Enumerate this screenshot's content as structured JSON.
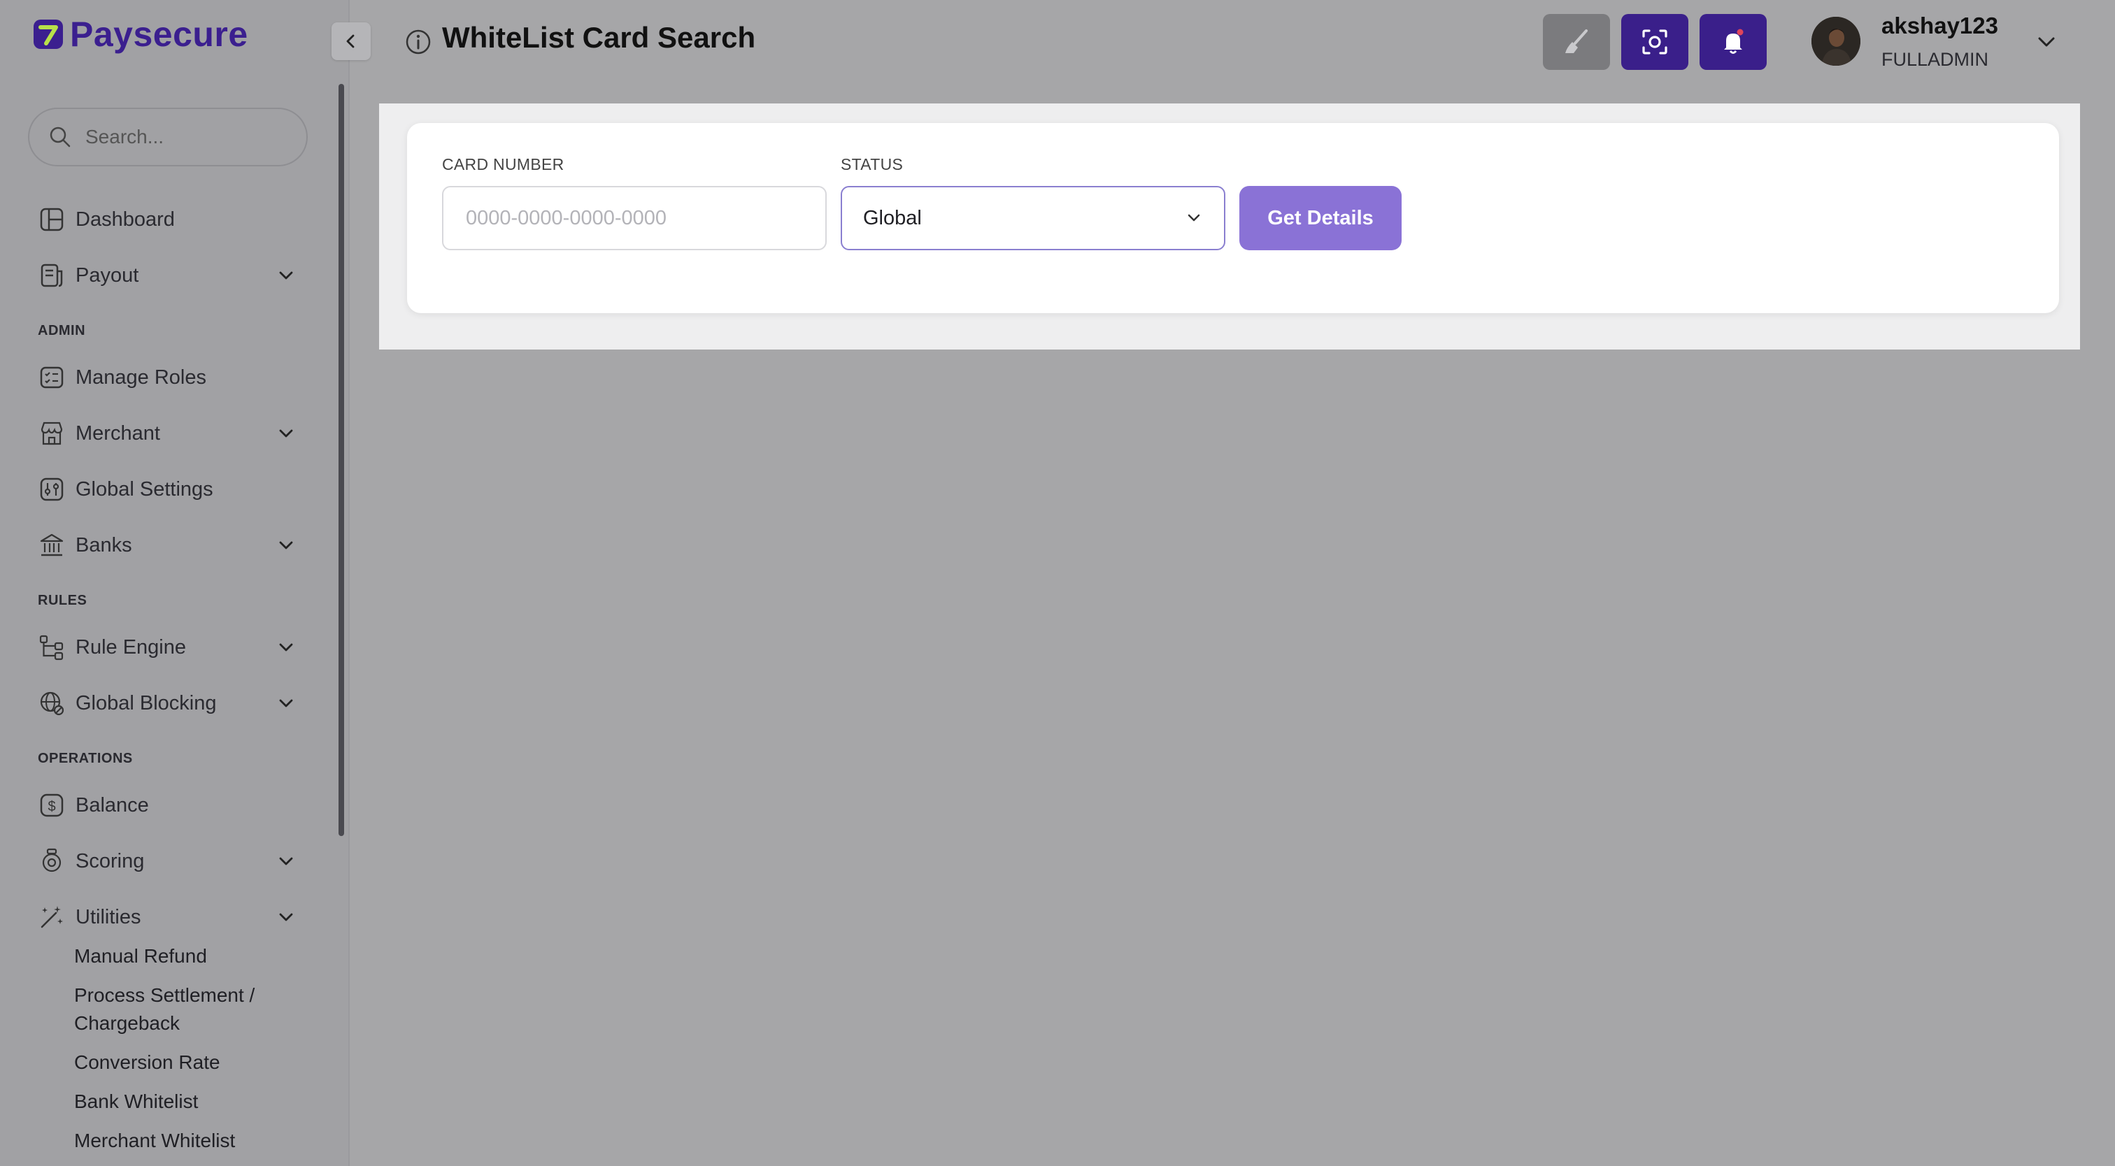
{
  "brand": {
    "name": "Paysecure",
    "accent": "#3b1f8f"
  },
  "search": {
    "placeholder": "Search..."
  },
  "nav": {
    "dashboard": "Dashboard",
    "payout": "Payout",
    "admin_section": "ADMIN",
    "manage_roles": "Manage Roles",
    "merchant": "Merchant",
    "global_settings": "Global Settings",
    "banks": "Banks",
    "rules_section": "RULES",
    "rule_engine": "Rule Engine",
    "global_blocking": "Global Blocking",
    "operations_section": "OPERATIONS",
    "balance": "Balance",
    "scoring": "Scoring",
    "utilities": "Utilities",
    "utilities_sub": [
      "Manual Refund",
      "Process Settlement / Chargeback",
      "Conversion Rate",
      "Bank Whitelist",
      "Merchant Whitelist"
    ]
  },
  "header": {
    "title": "WhiteList Card Search",
    "user_name": "akshay123",
    "user_role": "FULLADMIN",
    "button_colors": {
      "grey": "#7b7b7e",
      "purple": "#3a1f8a"
    }
  },
  "form": {
    "card_number_label": "CARD NUMBER",
    "card_number_placeholder": "0000-0000-0000-0000",
    "card_number_value": "",
    "status_label": "STATUS",
    "status_value": "Global",
    "submit_label": "Get Details",
    "submit_color": "#8a72d6"
  }
}
